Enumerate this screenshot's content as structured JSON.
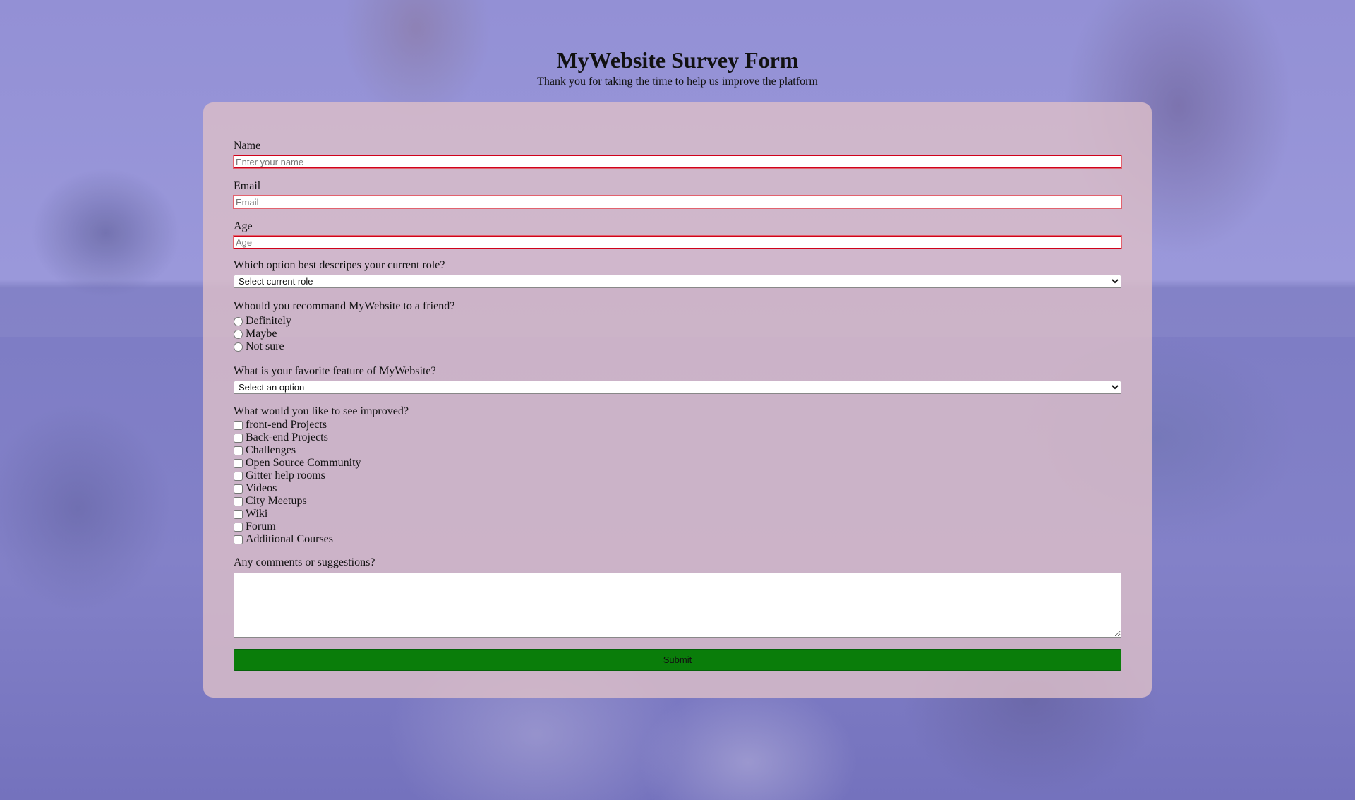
{
  "header": {
    "title": "MyWebsite Survey Form",
    "description": "Thank you for taking the time to help us improve the platform"
  },
  "form": {
    "name": {
      "label": "Name",
      "placeholder": "Enter your name",
      "value": ""
    },
    "email": {
      "label": "Email",
      "placeholder": "Email",
      "value": ""
    },
    "age": {
      "label": "Age",
      "placeholder": "Age",
      "value": ""
    },
    "role": {
      "label": "Which option best descripes your current role?",
      "selected": "Select current role"
    },
    "recommend": {
      "label": "Whould you recommand MyWebsite to a friend?",
      "options": [
        "Definitely",
        "Maybe",
        "Not sure"
      ]
    },
    "feature": {
      "label": "What is your favorite feature of MyWebsite?",
      "selected": "Select an option"
    },
    "improvements": {
      "label": "What would you like to see improved?",
      "options": [
        "front-end Projects",
        "Back-end Projects",
        "Challenges",
        "Open Source Community",
        "Gitter help rooms",
        "Videos",
        "City Meetups",
        "Wiki",
        "Forum",
        "Additional Courses"
      ]
    },
    "comments": {
      "label": "Any comments or suggestions?",
      "value": ""
    },
    "submit_label": "Submit"
  },
  "colors": {
    "card_background": "#dcbec8",
    "input_border": "#d0021b",
    "submit_background": "#0a7d0a",
    "page_tint": "#8e8bd3"
  }
}
